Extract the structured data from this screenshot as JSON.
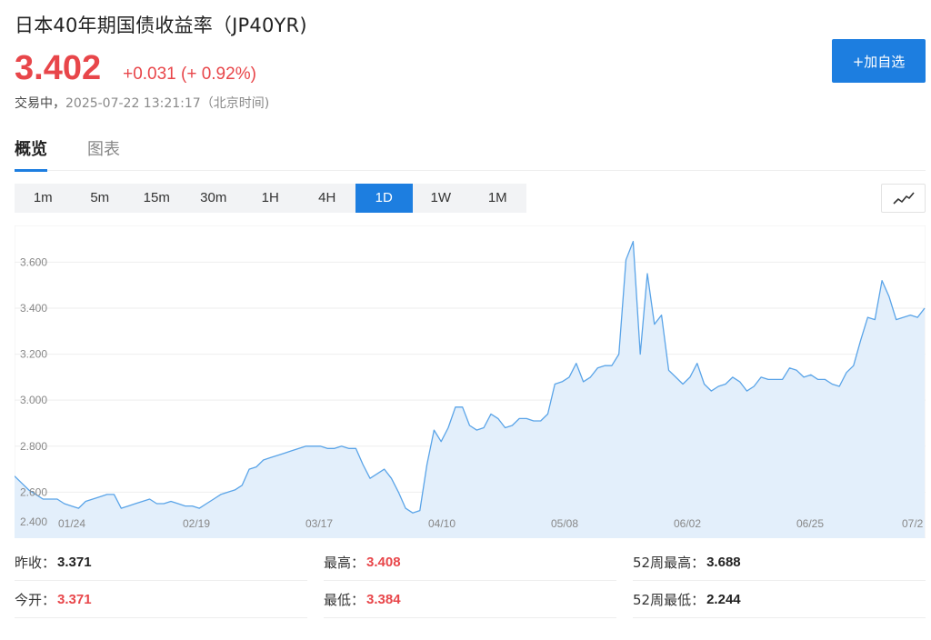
{
  "header": {
    "title": "日本40年期国债收益率（JP40YR)",
    "price": "3.402",
    "change": "+0.031 (+ 0.92%)",
    "status": "交易中，",
    "timestamp": "2025-07-22 13:21:17（北京时间)",
    "add_button": "+加自选"
  },
  "tabs": [
    {
      "label": "概览",
      "active": true
    },
    {
      "label": "图表",
      "active": false
    }
  ],
  "periods": [
    {
      "label": "1m"
    },
    {
      "label": "5m"
    },
    {
      "label": "15m"
    },
    {
      "label": "30m"
    },
    {
      "label": "1H"
    },
    {
      "label": "4H"
    },
    {
      "label": "1D",
      "active": true
    },
    {
      "label": "1W"
    },
    {
      "label": "1M"
    }
  ],
  "chart_icon": "line-chart-icon",
  "colors": {
    "up": "#e8464a",
    "accent": "#1d7ee0",
    "line": "#5aa4e8",
    "area": "#e3effb"
  },
  "chart_data": {
    "type": "area",
    "ylim": [
      2.4,
      3.72
    ],
    "y_ticks": [
      "2.400",
      "2.600",
      "2.800",
      "3.000",
      "3.200",
      "3.400",
      "3.600"
    ],
    "x_ticks": [
      "01/24",
      "02/19",
      "03/17",
      "04/10",
      "05/08",
      "06/02",
      "06/25",
      "07/2"
    ],
    "grid": true,
    "values": [
      2.67,
      2.64,
      2.61,
      2.59,
      2.57,
      2.57,
      2.57,
      2.55,
      2.54,
      2.53,
      2.56,
      2.57,
      2.58,
      2.59,
      2.59,
      2.53,
      2.54,
      2.55,
      2.56,
      2.57,
      2.55,
      2.55,
      2.56,
      2.55,
      2.54,
      2.54,
      2.53,
      2.55,
      2.57,
      2.59,
      2.6,
      2.61,
      2.63,
      2.7,
      2.71,
      2.74,
      2.75,
      2.76,
      2.77,
      2.78,
      2.79,
      2.8,
      2.8,
      2.8,
      2.79,
      2.79,
      2.8,
      2.79,
      2.79,
      2.72,
      2.66,
      2.68,
      2.7,
      2.66,
      2.6,
      2.53,
      2.51,
      2.52,
      2.72,
      2.87,
      2.82,
      2.88,
      2.97,
      2.97,
      2.89,
      2.87,
      2.88,
      2.94,
      2.92,
      2.88,
      2.89,
      2.92,
      2.92,
      2.91,
      2.91,
      2.94,
      3.07,
      3.08,
      3.1,
      3.16,
      3.08,
      3.1,
      3.14,
      3.15,
      3.15,
      3.2,
      3.61,
      3.69,
      3.2,
      3.55,
      3.33,
      3.37,
      3.13,
      3.1,
      3.07,
      3.1,
      3.16,
      3.07,
      3.04,
      3.06,
      3.07,
      3.1,
      3.08,
      3.04,
      3.06,
      3.1,
      3.09,
      3.09,
      3.09,
      3.14,
      3.13,
      3.1,
      3.11,
      3.09,
      3.09,
      3.07,
      3.06,
      3.12,
      3.15,
      3.26,
      3.36,
      3.35,
      3.52,
      3.45,
      3.35,
      3.36,
      3.37,
      3.36,
      3.4
    ]
  },
  "stats": [
    [
      {
        "label": "昨收：",
        "value": "3.371",
        "style": "neutral"
      },
      {
        "label": "最高：",
        "value": "3.408",
        "style": "up"
      },
      {
        "label": "52周最高：",
        "value": "3.688",
        "style": "neutral"
      }
    ],
    [
      {
        "label": "今开：",
        "value": "3.371",
        "style": "up"
      },
      {
        "label": "最低：",
        "value": "3.384",
        "style": "up"
      },
      {
        "label": "52周最低：",
        "value": "2.244",
        "style": "neutral"
      }
    ]
  ]
}
